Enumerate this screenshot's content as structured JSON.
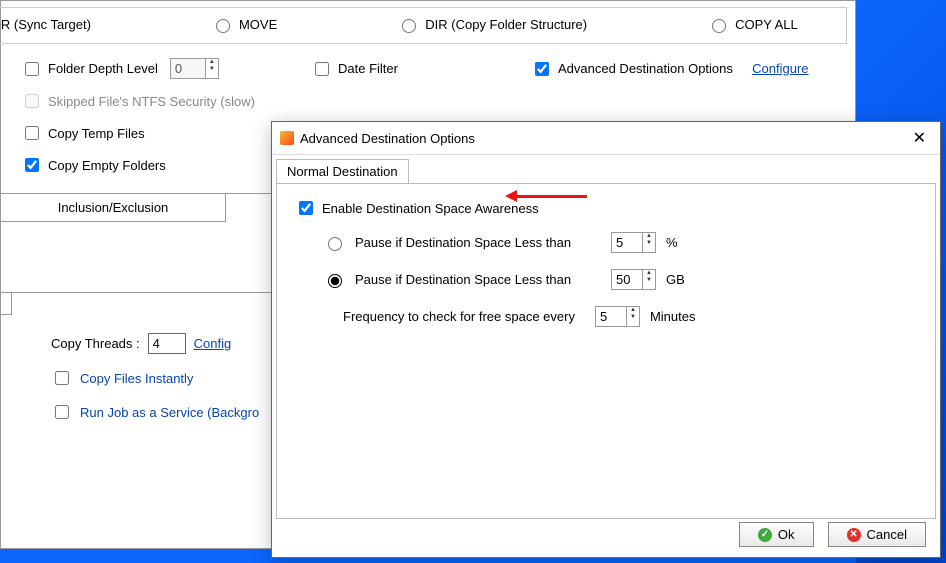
{
  "topModes": {
    "rror": "RROR (Sync Target)",
    "move": "MOVE",
    "dir": "DIR (Copy Folder Structure)",
    "copyall": "COPY ALL"
  },
  "opts": {
    "folderDepth": "Folder Depth Level",
    "folderDepthVal": "0",
    "dateFilter": "Date Filter",
    "advDest": "Advanced Destination Options",
    "configure": "Configure",
    "skippedNtfs": "Skipped File's NTFS Security (slow)",
    "copyTemp": "Copy Temp Files",
    "copyEmpty": "Copy Empty Folders"
  },
  "inclExcl": "Inclusion/Exclusion",
  "lower": {
    "copyThreads": "Copy Threads :",
    "copyThreadsVal": "4",
    "config": "Config",
    "copyInstantly": "Copy Files Instantly",
    "runService": "Run Job as a Service (Backgro"
  },
  "dialog": {
    "title": "Advanced Destination Options",
    "tab": "Normal Destination",
    "enable": "Enable Destination Space Awareness",
    "pauseLess": "Pause if Destination Space Less than",
    "pctVal": "5",
    "pct": "%",
    "gbVal": "50",
    "gb": "GB",
    "freq": "Frequency to check for free space every",
    "freqVal": "5",
    "minutes": "Minutes",
    "ok": "Ok",
    "cancel": "Cancel"
  }
}
